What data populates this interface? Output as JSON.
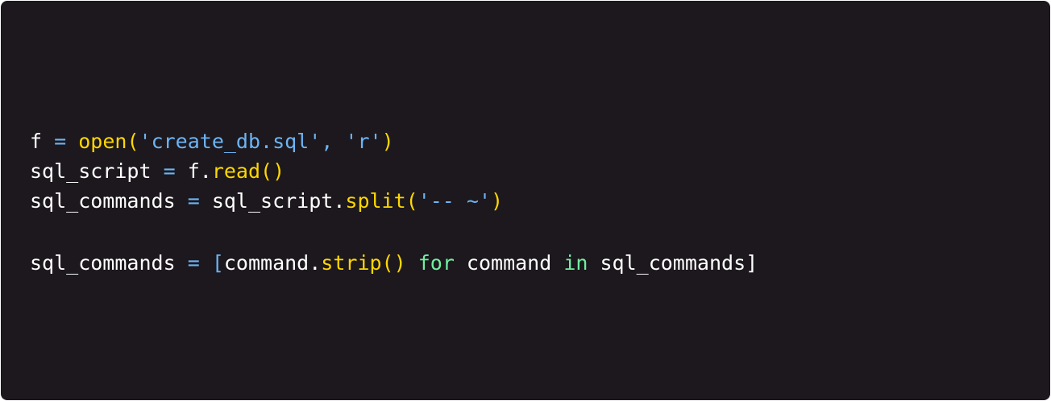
{
  "colors": {
    "background": "#1c181d",
    "identifier": "#ffffff",
    "operator": "#6cb4f5",
    "function": "#ffd700",
    "string": "#6cb4f5",
    "keyword": "#6ff0a0"
  },
  "code": {
    "line1": {
      "t1": "f",
      "t2": " ",
      "t3": "=",
      "t4": " ",
      "t5": "open(",
      "t6": "'create_db.sql'",
      "t7": ", ",
      "t8": "'r'",
      "t9": ")"
    },
    "line2": {
      "t1": "sql_script",
      "t2": " ",
      "t3": "=",
      "t4": " ",
      "t5": "f.",
      "t6": "read()"
    },
    "line3": {
      "t1": "sql_commands",
      "t2": " ",
      "t3": "=",
      "t4": " ",
      "t5": "sql_script.",
      "t6": "split(",
      "t7": "'-- ~'",
      "t8": ")"
    },
    "line5": {
      "t1": "sql_commands",
      "t2": " ",
      "t3": "=",
      "t4": " ",
      "t5": "[",
      "t6": "command.",
      "t7": "strip()",
      "t8": " ",
      "t9": "for",
      "t10": " command ",
      "t11": "in",
      "t12": " sql_commands]"
    }
  }
}
